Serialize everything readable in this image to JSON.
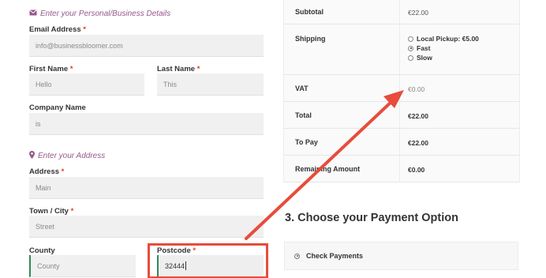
{
  "personal": {
    "heading": "Enter your Personal/Business Details",
    "email_label": "Email Address",
    "email_value": "info@businessbloomer.com",
    "first_name_label": "First Name",
    "first_name_value": "Hello",
    "last_name_label": "Last Name",
    "last_name_value": "This",
    "company_label": "Company Name",
    "company_value": "is",
    "required_marker": "*"
  },
  "address": {
    "heading": "Enter your Address",
    "address_label": "Address",
    "address_value": "Main",
    "city_label": "Town / City",
    "city_value": "Street",
    "county_label": "County",
    "county_value": "County",
    "postcode_label": "Postcode",
    "postcode_value": "32444"
  },
  "totals": {
    "subtotal_label": "Subtotal",
    "subtotal_value": "€22.00",
    "shipping_label": "Shipping",
    "shipping_options": [
      {
        "label": "Local Pickup: €5.00",
        "selected": false
      },
      {
        "label": "Fast",
        "selected": true
      },
      {
        "label": "Slow",
        "selected": false
      }
    ],
    "vat_label": "VAT",
    "vat_value": "€0.00",
    "total_label": "Total",
    "total_value": "€22.00",
    "topay_label": "To Pay",
    "topay_value": "€22.00",
    "remaining_label": "Remaining Amount",
    "remaining_value": "€0.00"
  },
  "payment": {
    "title": "3. Choose your Payment Option",
    "option_label": "Check Payments"
  },
  "colors": {
    "accent": "#96588a",
    "required": "#e2401c",
    "highlight": "#e74c3c"
  }
}
